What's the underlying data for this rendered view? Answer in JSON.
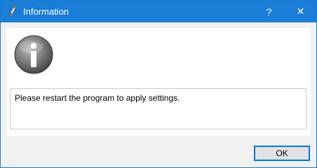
{
  "window": {
    "title": "Information",
    "help_label": "?",
    "close_label": "✕"
  },
  "dialog": {
    "icon": "information-icon",
    "message": "Please restart the program to apply settings.",
    "ok_label": "OK"
  },
  "colors": {
    "titlebar": "#1a7dd7",
    "dialog_background": "#f0f0f0",
    "button_border": "#0078d7"
  }
}
